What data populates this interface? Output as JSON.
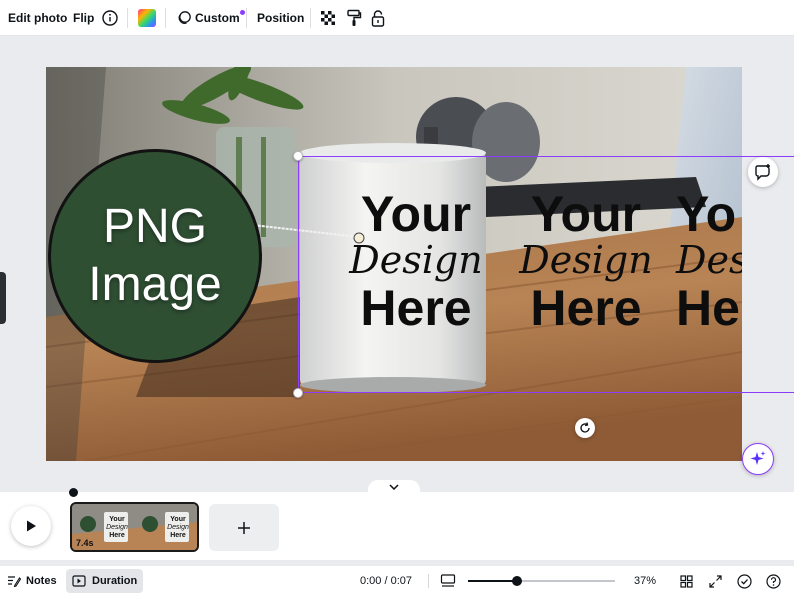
{
  "toolbar": {
    "edit_photo": "Edit photo",
    "flip": "Flip",
    "custom": "Custom",
    "position": "Position",
    "accent": "#8b3dff"
  },
  "design": {
    "badge_line1": "PNG",
    "badge_line2": "Image",
    "badge_color": "#2f4f33",
    "mug_text": [
      {
        "line1": "Your",
        "line2": "Design",
        "line3": "Here"
      },
      {
        "line1": "Your",
        "line2": "Design",
        "line3": "Here"
      },
      {
        "line1": "Yo",
        "line2": "Des",
        "line3": "He"
      }
    ]
  },
  "timeline": {
    "clip_duration": "7.4s",
    "clip_text": [
      {
        "line1": "Your",
        "line2": "Design",
        "line3": "Here"
      },
      {
        "line1": "Your",
        "line2": "Design",
        "line3": "Here"
      }
    ]
  },
  "bottom": {
    "notes": "Notes",
    "duration": "Duration",
    "time": "0:00 / 0:07",
    "zoom": "37%",
    "zoom_fraction": 0.33
  }
}
